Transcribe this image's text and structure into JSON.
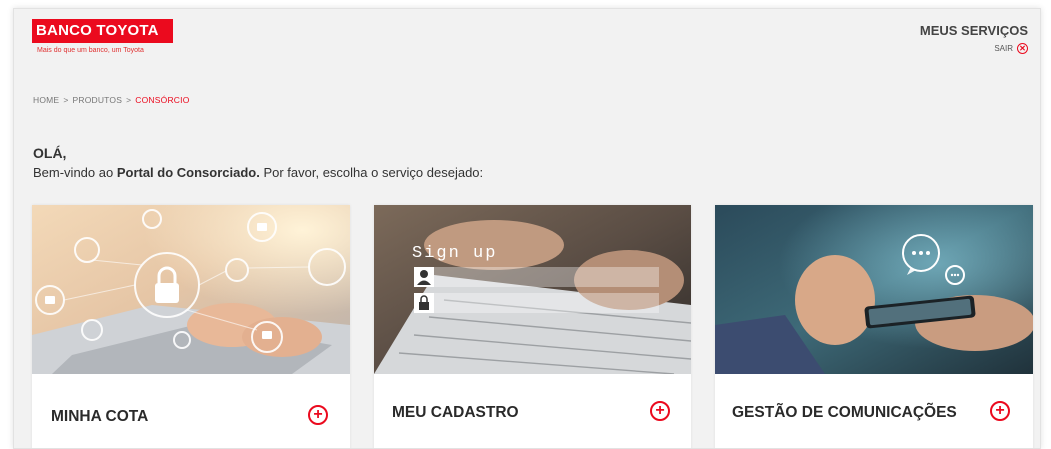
{
  "header": {
    "brand": "BANCO TOYOTA",
    "tagline": "Mais do que um banco, um Toyota",
    "services_title": "MEUS SERVIÇOS",
    "logout_label": "SAIR"
  },
  "breadcrumb": {
    "home": "HOME",
    "separator": ">",
    "products": "PRODUTOS",
    "current": "CONSÓRCIO"
  },
  "greeting": {
    "hello": "OLÁ,",
    "welcome_prefix": "Bem-vindo ao ",
    "portal_name": "Portal do Consorciado.",
    "welcome_suffix": " Por favor, escolha o serviço desejado:"
  },
  "cards": [
    {
      "label": "MINHA COTA",
      "icon": "plus-circle-icon"
    },
    {
      "label": "MEU CADASTRO",
      "icon": "plus-circle-icon",
      "image_text": "Sign up"
    },
    {
      "label": "GESTÃO DE COMUNICAÇÕES",
      "icon": "plus-circle-icon"
    }
  ],
  "colors": {
    "accent": "#eb0a1e",
    "background": "#f2f2f2",
    "text": "#333333"
  }
}
